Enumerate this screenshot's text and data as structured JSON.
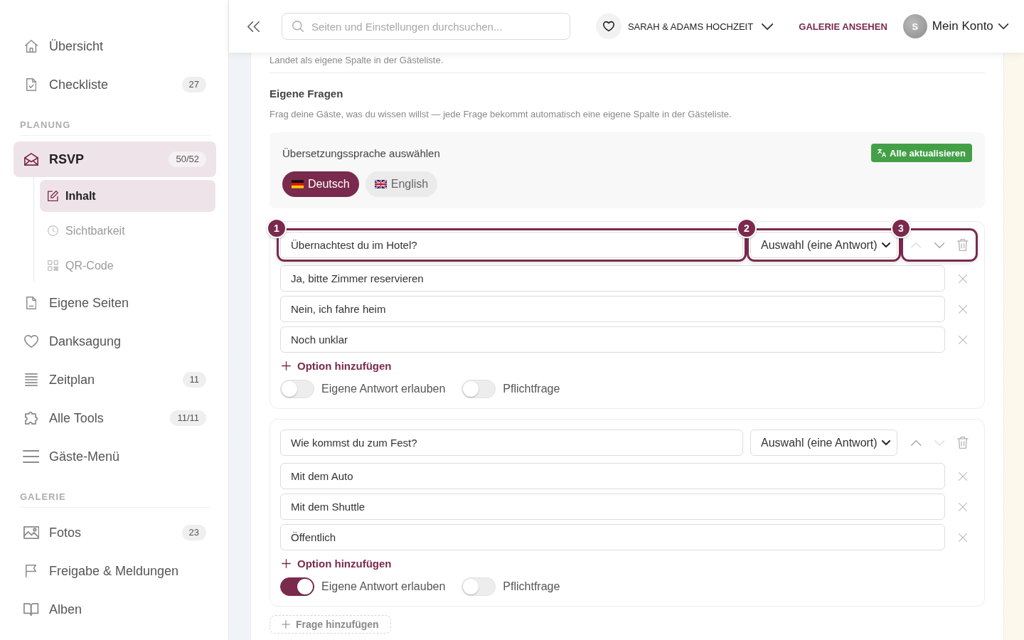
{
  "sidebar": {
    "sections": [
      {
        "items": [
          {
            "label": "Übersicht",
            "selected": false
          },
          {
            "label": "Checkliste",
            "badge": "27",
            "selected": false
          }
        ]
      },
      {
        "heading": "PLANUNG",
        "items": [
          {
            "label": "RSVP",
            "badge": "50/52",
            "selected": true,
            "children": [
              {
                "label": "Inhalt",
                "selected": true
              },
              {
                "label": "Sichtbarkeit",
                "selected": false
              },
              {
                "label": "QR-Code",
                "selected": false
              }
            ]
          },
          {
            "label": "Eigene Seiten",
            "selected": false
          },
          {
            "label": "Danksagung",
            "selected": false
          },
          {
            "label": "Zeitplan",
            "badge": "11",
            "selected": false
          },
          {
            "label": "Alle Tools",
            "badge": "11/11",
            "selected": false
          },
          {
            "label": "Gäste-Menü",
            "selected": false
          }
        ]
      },
      {
        "heading": "GALERIE",
        "items": [
          {
            "label": "Fotos",
            "badge": "23",
            "selected": false
          },
          {
            "label": "Freigabe & Meldungen",
            "selected": false
          },
          {
            "label": "Alben",
            "selected": false
          }
        ]
      }
    ]
  },
  "topbar": {
    "search": {
      "placeholder": "Seiten und Einstellungen durchsuchen..."
    },
    "event": "SARAH & ADAMS HOCHZEIT",
    "gallery_link": "GALERIE ANSEHEN",
    "account": {
      "initial": "S",
      "label": "Mein Konto"
    }
  },
  "content": {
    "hint": "Landet als eigene Spalte in der Gästeliste.",
    "title": "Eigene Fragen",
    "description": "Frag deine Gäste, was du wissen willst — jede Frage bekommt automatisch eine eigene Spalte in der Gästeliste.",
    "translation": {
      "title": "Übersetzungssprache auswählen",
      "update_button": "Alle aktualisieren",
      "languages": [
        {
          "label": "Deutsch",
          "selected": true
        },
        {
          "label": "English",
          "selected": false
        }
      ]
    },
    "questions": [
      {
        "text": "Übernachtest du im Hotel?",
        "answer_type": "Auswahl (eine Antwort)",
        "move_up_disabled": true,
        "move_down_disabled": false,
        "options": [
          "Ja, bitte Zimmer reservieren",
          "Nein, ich fahre heim",
          "Noch unklar"
        ],
        "add_option": "Option hinzufügen",
        "toggles": [
          {
            "label": "Eigene Antwort erlauben",
            "on": false
          },
          {
            "label": "Pflichtfrage",
            "on": false
          }
        ],
        "tour_steps": [
          {
            "number": "1",
            "kind": "question"
          },
          {
            "number": "2",
            "kind": "answer_type"
          },
          {
            "number": "3",
            "kind": "actions"
          }
        ]
      },
      {
        "text": "Wie kommst du zum Fest?",
        "answer_type": "Auswahl (eine Antwort)",
        "move_up_disabled": false,
        "move_down_disabled": true,
        "options": [
          "Mit dem Auto",
          "Mit dem Shuttle",
          "Öffentlich"
        ],
        "add_option": "Option hinzufügen",
        "toggles": [
          {
            "label": "Eigene Antwort erlauben",
            "on": true
          },
          {
            "label": "Pflichtfrage",
            "on": false
          }
        ]
      }
    ],
    "add_question": "Frage hinzufügen"
  }
}
